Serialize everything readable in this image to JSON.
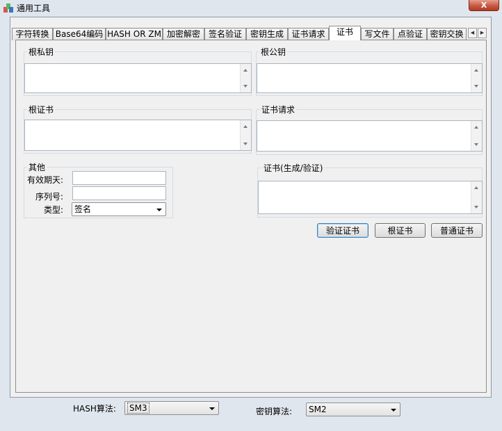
{
  "window": {
    "title": "通用工具",
    "close_label": "X"
  },
  "tabs": [
    {
      "label": "字符转换"
    },
    {
      "label": "Base64编码"
    },
    {
      "label": "HASH OR ZM"
    },
    {
      "label": "加密解密"
    },
    {
      "label": "签名验证"
    },
    {
      "label": "密钥生成"
    },
    {
      "label": "证书请求"
    },
    {
      "label": "证书",
      "active": true
    },
    {
      "label": "写文件"
    },
    {
      "label": "点验证"
    },
    {
      "label": "密钥交换"
    }
  ],
  "tab_scroll": {
    "left": "◀",
    "right": "▶"
  },
  "groups": {
    "root_private_key": {
      "title": "根私钥",
      "value": ""
    },
    "root_public_key": {
      "title": "根公钥",
      "value": ""
    },
    "root_cert": {
      "title": "根证书",
      "value": ""
    },
    "cert_request": {
      "title": "证书请求",
      "value": ""
    },
    "cert_gen_verify": {
      "title": "证书(生成/验证)",
      "value": ""
    }
  },
  "other": {
    "title": "其他",
    "validity_label": "有效期天:",
    "validity_value": "",
    "serial_label": "序列号:",
    "serial_value": "",
    "type_label": "类型:",
    "type_value": "签名"
  },
  "buttons": {
    "verify_cert": "验证证书",
    "root_cert": "根证书",
    "normal_cert": "普通证书"
  },
  "bottom": {
    "hash_label": "HASH算法:",
    "hash_value": "SM3",
    "key_label": "密钥算法:",
    "key_value": "SM2"
  }
}
